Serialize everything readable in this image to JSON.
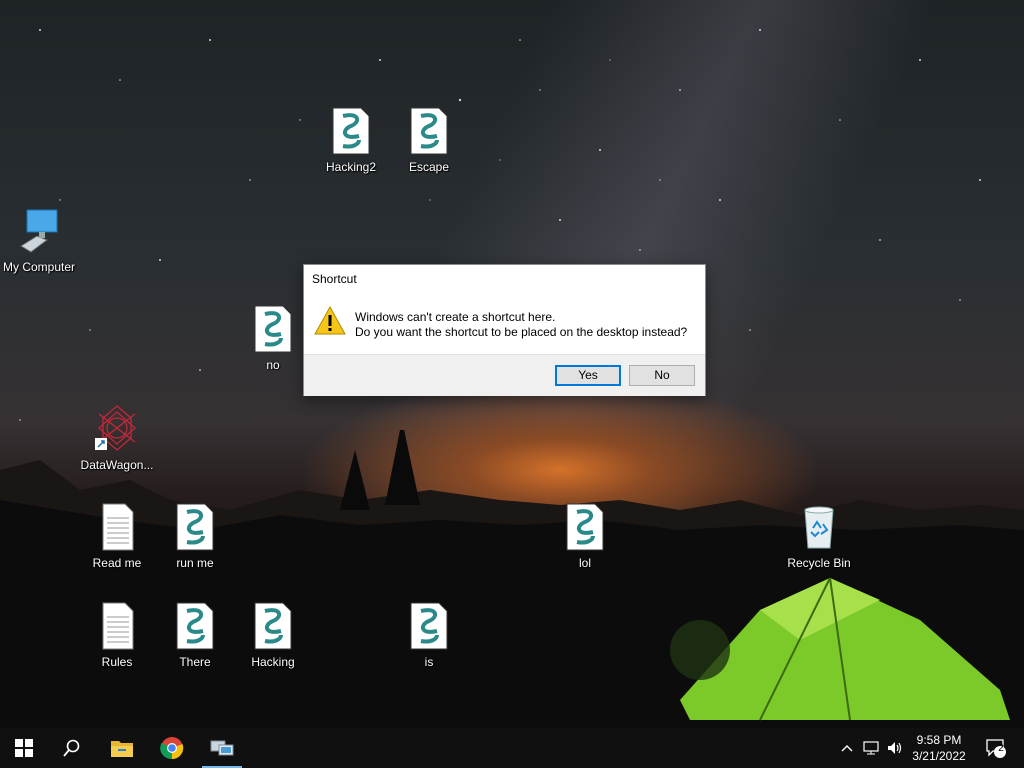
{
  "desktop": {
    "icons": [
      {
        "label": "Hacking2",
        "icon": "script-icon"
      },
      {
        "label": "Escape",
        "icon": "script-icon"
      },
      {
        "label": "My Computer",
        "icon": "computer-icon"
      },
      {
        "label": "no",
        "icon": "script-icon"
      },
      {
        "label": "DataWagon...",
        "icon": "datawagon-shortcut-icon"
      },
      {
        "label": "Read me",
        "icon": "text-file-icon"
      },
      {
        "label": "run me",
        "icon": "script-icon"
      },
      {
        "label": "lol",
        "icon": "script-icon"
      },
      {
        "label": "Recycle Bin",
        "icon": "recycle-bin-icon"
      },
      {
        "label": "Rules",
        "icon": "text-file-icon"
      },
      {
        "label": "There",
        "icon": "script-icon"
      },
      {
        "label": "Hacking",
        "icon": "script-icon"
      },
      {
        "label": "is",
        "icon": "script-icon"
      }
    ]
  },
  "dialog": {
    "title": "Shortcut",
    "line1": "Windows can't create a shortcut here.",
    "line2": "Do you want the shortcut to be placed on the desktop instead?",
    "yes_label": "Yes",
    "no_label": "No",
    "icon": "warning-icon"
  },
  "taskbar": {
    "items": [
      "start-icon",
      "search-icon",
      "file-explorer-icon",
      "chrome-icon",
      "network-app-icon"
    ],
    "tray": [
      "chevron-up-icon",
      "network-icon",
      "volume-icon"
    ],
    "time": "9:58 PM",
    "date": "3/21/2022",
    "notification_count": "2",
    "accent": "#0078d7"
  }
}
